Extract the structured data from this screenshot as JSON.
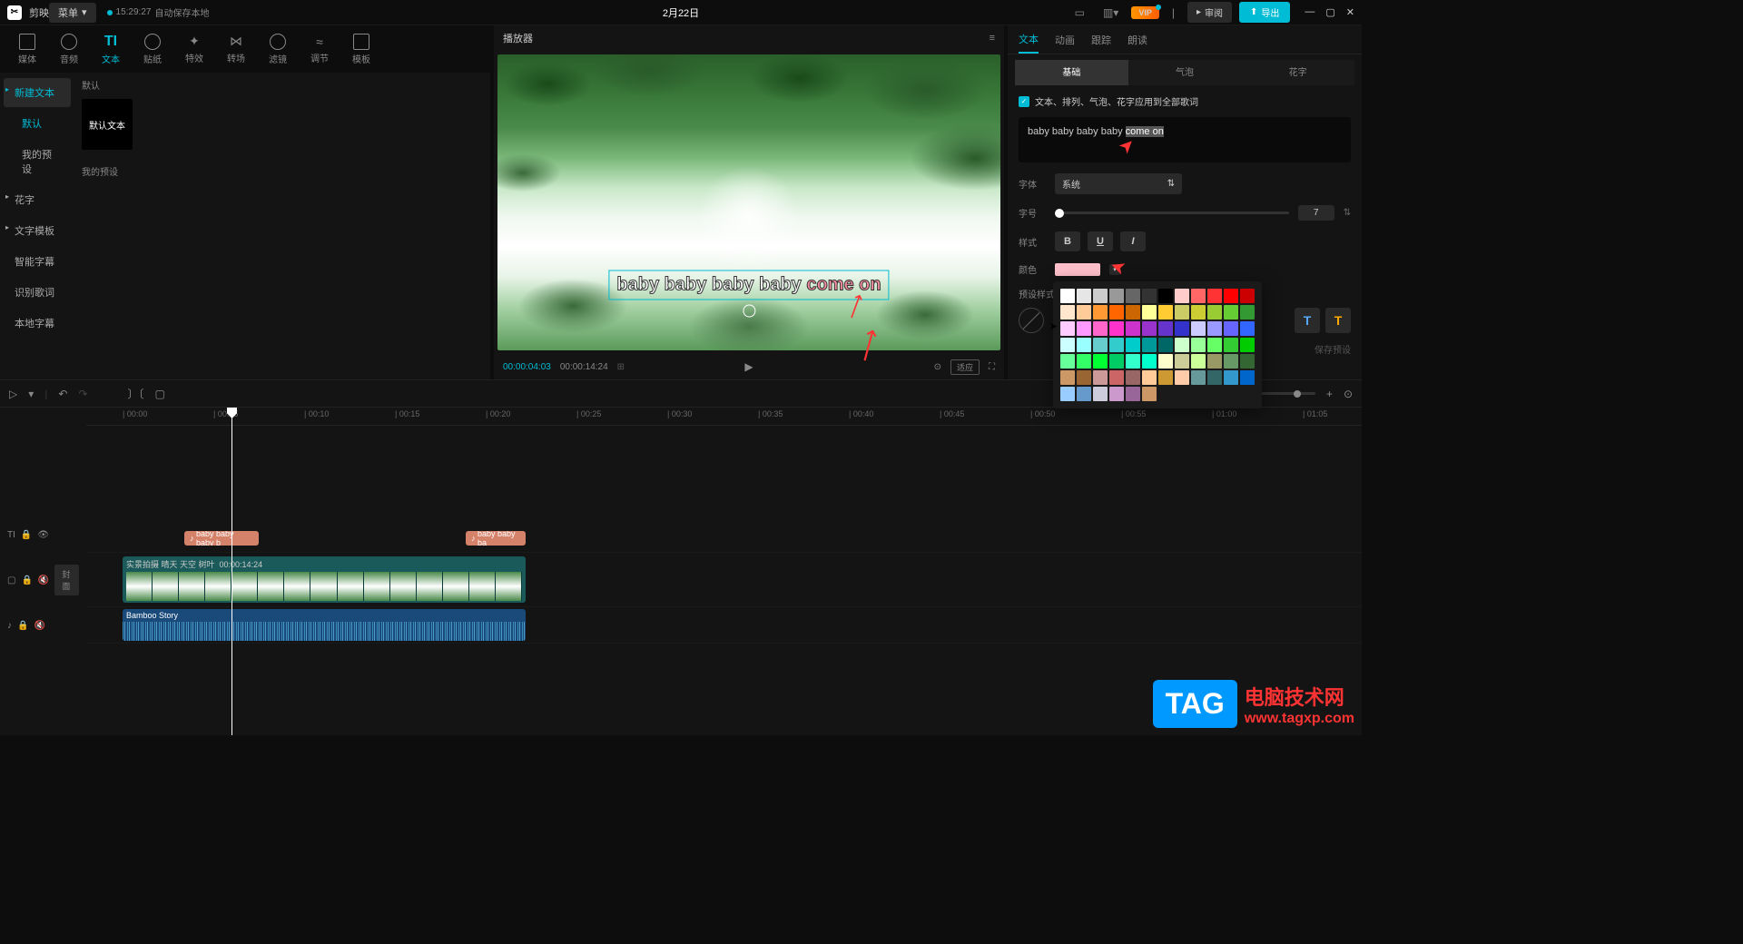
{
  "header": {
    "app_logo": "✂",
    "app_name": "剪映",
    "menu": "菜单",
    "save_time": "15:29:27",
    "save_text": "自动保存本地",
    "project": "2月22日",
    "vip": "VIP",
    "review": "审阅",
    "export": "导出"
  },
  "tool_tabs": [
    {
      "label": "媒体"
    },
    {
      "label": "音频"
    },
    {
      "label": "文本"
    },
    {
      "label": "贴纸"
    },
    {
      "label": "特效"
    },
    {
      "label": "转场"
    },
    {
      "label": "滤镜"
    },
    {
      "label": "调节"
    },
    {
      "label": "模板"
    }
  ],
  "sidebar": {
    "items": [
      {
        "label": "新建文本",
        "arrow": true,
        "active": true
      },
      {
        "label": "默认",
        "arrow": false,
        "active": false
      },
      {
        "label": "我的预设",
        "arrow": false,
        "active": false
      },
      {
        "label": "花字",
        "arrow": true,
        "active": false
      },
      {
        "label": "文字模板",
        "arrow": true,
        "active": false
      },
      {
        "label": "智能字幕",
        "arrow": false,
        "active": false
      },
      {
        "label": "识别歌词",
        "arrow": false,
        "active": false
      },
      {
        "label": "本地字幕",
        "arrow": false,
        "active": false
      }
    ],
    "section1": "默认",
    "preset1": "默认文本",
    "section2": "我的预设"
  },
  "player": {
    "title": "播放器",
    "overlay_white": "baby baby baby baby ",
    "overlay_pink": "come on",
    "time_current": "00:00:04:03",
    "time_total": "00:00:14:24",
    "scale": "适应"
  },
  "right": {
    "tabs": [
      "文本",
      "动画",
      "跟踪",
      "朗读"
    ],
    "subtabs": [
      "基础",
      "气泡",
      "花字"
    ],
    "apply_all": "文本、排列、气泡、花字应用到全部歌词",
    "text_prefix": "baby baby baby baby ",
    "text_highlight": "come on",
    "font_label": "字体",
    "font_value": "系统",
    "size_label": "字号",
    "size_value": "7",
    "style_label": "样式",
    "color_label": "颜色",
    "preset_label": "预设样式",
    "save_preset": "保存预设"
  },
  "color_palette": [
    [
      "#ffffff",
      "#e6e6e6",
      "#cccccc",
      "#999999",
      "#666666",
      "#333333",
      "#000000",
      "#ffcccc",
      "#ff6666",
      "#ff3333",
      "#ff0000",
      "#cc0000"
    ],
    [
      "#ffe6cc",
      "#ffcc99",
      "#ff9933",
      "#ff6600",
      "#cc6600",
      "#ffff99",
      "#ffcc33",
      "#cccc66",
      "#cccc33",
      "#99cc33",
      "#66cc33",
      "#339933"
    ],
    [
      "#ffccff",
      "#ff99ff",
      "#ff66cc",
      "#ff33cc",
      "#cc33cc",
      "#9933cc",
      "#6633cc",
      "#3333cc",
      "#ccccff",
      "#9999ff",
      "#6666ff",
      "#3366ff"
    ],
    [
      "#ccffff",
      "#99ffff",
      "#66cccc",
      "#33cccc",
      "#00cccc",
      "#009999",
      "#006666",
      "#ccffcc",
      "#99ff99",
      "#66ff66",
      "#33cc33",
      "#00cc00"
    ],
    [
      "#66ff99",
      "#33ff66",
      "#00ff33",
      "#00cc66",
      "#33ffcc",
      "#00ffcc",
      "#ffffcc",
      "#cccc99",
      "#ccff99",
      "#999966",
      "#669966",
      "#336633"
    ],
    [
      "#cc9966",
      "#996633",
      "#cc9999",
      "#cc6666",
      "#996666",
      "#ffcc99",
      "#cc9933",
      "#ffccaa",
      "#669999",
      "#336666",
      "#3399cc",
      "#0066cc"
    ],
    [
      "#99ccff",
      "#6699cc",
      "#ccccdd",
      "#cc99cc",
      "#996699",
      "#cc9966",
      "",
      "",
      "",
      "",
      "",
      ""
    ]
  ],
  "timeline": {
    "ruler": [
      "00:00",
      "00:05",
      "00:10",
      "00:15",
      "00:20",
      "00:25",
      "00:30",
      "00:35",
      "00:40",
      "00:45",
      "00:50",
      "00:55",
      "01:00",
      "01:05"
    ],
    "cover": "封面",
    "text_clip1": "baby baby baby b",
    "text_clip2": "baby baby ba",
    "video_name": "实景拍摄 晴天 天空 树叶",
    "video_dur": "00:00:14:24",
    "audio_name": "Bamboo Story"
  },
  "watermark": {
    "tag": "TAG",
    "cn": "电脑技术网",
    "url": "www.tagxp.com"
  }
}
